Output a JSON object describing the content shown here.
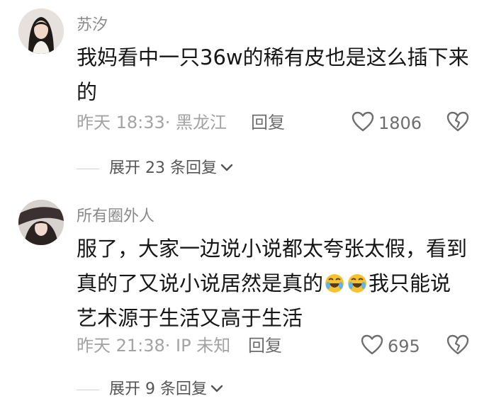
{
  "comments": [
    {
      "username": "苏汐",
      "content": "我妈看中一只36w的稀有皮也是这么插下来的",
      "time": "昨天 18:33",
      "location": "· 黑龙江",
      "reply_label": "回复",
      "likes": "1806",
      "replies_label": "展开 23 条回复",
      "avatar_icon": "avatar-woman-photo"
    },
    {
      "username": "所有圈外人",
      "content_parts": [
        "服了，大家一边说小说都太夸张太假，看到真的了又说小说居然是真的",
        "我只能说艺术源于生活又高于生活"
      ],
      "emoji": "rolling-on-floor-laughing-emoji",
      "time": "昨天 21:38",
      "location": "· IP 未知",
      "reply_label": "回复",
      "likes": "695",
      "replies_label": "展开 9 条回复",
      "avatar_icon": "avatar-anime-girl"
    }
  ],
  "colors": {
    "username": "#8a8a8a",
    "content": "#161616",
    "meta": "#a3a3a3",
    "action": "#6e6e6e",
    "emoji": "#f6c330"
  }
}
